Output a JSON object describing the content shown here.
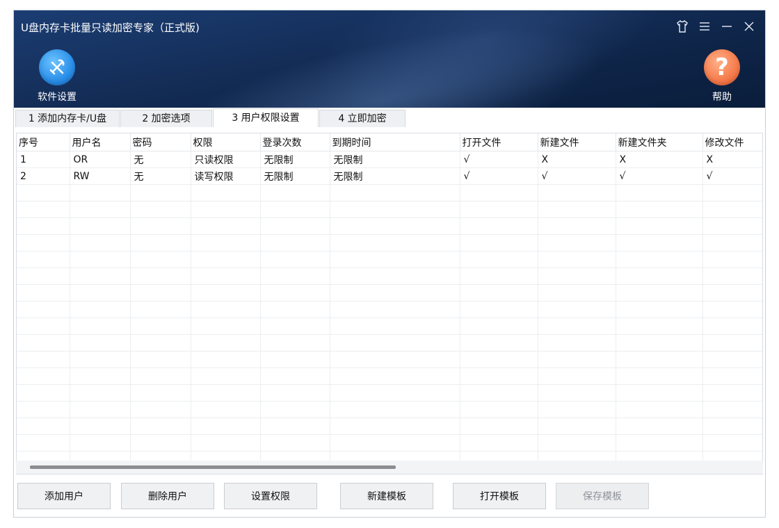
{
  "window": {
    "title": "U盘内存卡批量只读加密专家（正式版)"
  },
  "toolbar": {
    "settings_label": "软件设置",
    "help_label": "帮助"
  },
  "tabs": [
    {
      "label": "1 添加内存卡/U盘",
      "active": false
    },
    {
      "label": "2 加密选项",
      "active": false
    },
    {
      "label": "3 用户权限设置",
      "active": true
    },
    {
      "label": "4 立即加密",
      "active": false
    }
  ],
  "grid": {
    "columns": [
      "序号",
      "用户名",
      "密码",
      "权限",
      "登录次数",
      "到期时间",
      "打开文件",
      "新建文件",
      "新建文件夹",
      "修改文件"
    ],
    "rows": [
      [
        "1",
        "OR",
        "无",
        "只读权限",
        "无限制",
        "无限制",
        "√",
        "X",
        "X",
        "X"
      ],
      [
        "2",
        "RW",
        "无",
        "读写权限",
        "无限制",
        "无限制",
        "√",
        "√",
        "√",
        "√"
      ]
    ]
  },
  "buttons": {
    "add_user": "添加用户",
    "delete_user": "删除用户",
    "set_permission": "设置权限",
    "new_template": "新建模板",
    "open_template": "打开模板",
    "save_template": "保存模板"
  },
  "icons": {
    "settings": "wrench-screwdriver-icon",
    "help": "question-mark-icon",
    "skin": "shirt-icon",
    "menu": "menu-icon",
    "minimize": "minimize-icon",
    "close": "close-icon"
  },
  "colors": {
    "header_dark": "#0e2447",
    "settings_icon": "#2a8ee8",
    "help_icon": "#f57a4a"
  }
}
